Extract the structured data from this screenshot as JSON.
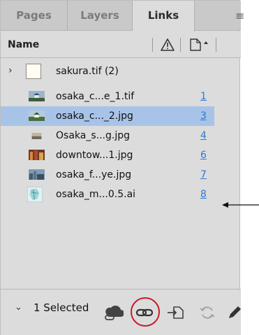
{
  "tabs": [
    {
      "label": "Pages",
      "active": false
    },
    {
      "label": "Layers",
      "active": false
    },
    {
      "label": "Links",
      "active": true
    }
  ],
  "panel_menu_icon": "hamburger-menu-icon",
  "header": {
    "name_label": "Name",
    "status_icon": "warning-triangle-icon",
    "page_icon": "page-sort-icon"
  },
  "links": [
    {
      "name": "sakura.tif (2)",
      "page": "",
      "icon": "blank-thumbnail",
      "expandable": true,
      "selected": false
    },
    {
      "name": "osaka_c...e_1.tif",
      "page": "1",
      "icon": "castle-thumbnail",
      "expandable": false,
      "selected": false
    },
    {
      "name": "osaka_c..._2.jpg",
      "page": "3",
      "icon": "castle-thumbnail",
      "expandable": false,
      "selected": true
    },
    {
      "name": "Osaka_s...g.jpg",
      "page": "4",
      "icon": "skyline-thumbnail",
      "expandable": false,
      "selected": false
    },
    {
      "name": "downtow...1.jpg",
      "page": "6",
      "icon": "city-night-thumbnail",
      "expandable": false,
      "selected": false
    },
    {
      "name": "osaka_f...ye.jpg",
      "page": "7",
      "icon": "city-day-thumbnail",
      "expandable": false,
      "selected": false
    },
    {
      "name": "osaka_m...0.5.ai",
      "page": "8",
      "icon": "map-thumbnail",
      "expandable": false,
      "selected": false
    }
  ],
  "footer": {
    "selection_label": "1 Selected",
    "buttons": [
      {
        "name": "cc-libraries-link-icon"
      },
      {
        "name": "relink-icon"
      },
      {
        "name": "go-to-link-icon"
      },
      {
        "name": "update-link-icon"
      },
      {
        "name": "edit-original-icon"
      }
    ]
  },
  "annotations": {
    "arrow_target_row": "osaka_m...0.5.ai",
    "circled_button": "relink-icon",
    "accent_color": "#c91c28",
    "selection_color": "#a7c4e8",
    "page_link_color": "#2f78d0"
  }
}
